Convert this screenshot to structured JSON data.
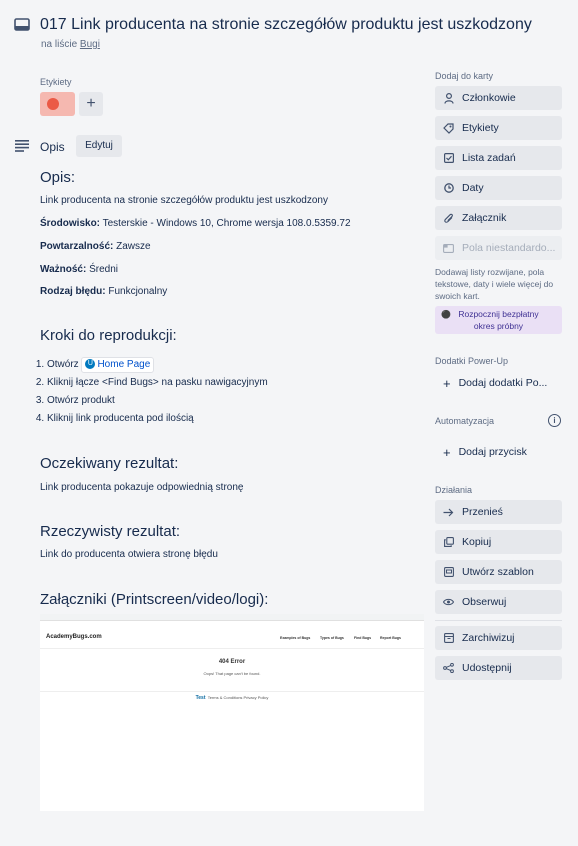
{
  "card": {
    "title": "017 Link producenta na stronie szczegółów produktu jest uszkodzony",
    "list_prefix": "na liście ",
    "list_name": "Bugi"
  },
  "labels": {
    "heading": "Etykiety",
    "color": "#eb5a46"
  },
  "description": {
    "section_label": "Opis",
    "edit_label": "Edytuj",
    "h_opis": "Opis:",
    "summary": "Link producenta na stronie szczegółów produktu jest uszkodzony",
    "env_label": "Środowisko:",
    "env_value": " Testerskie - Windows 10, Chrome wersja 108.0.5359.72",
    "rep_label": "Powtarzalność:",
    "rep_value": " Zawsze",
    "sev_label": "Ważność:",
    "sev_value": " Średni",
    "type_label": "Rodzaj błędu:",
    "type_value": " Funkcjonalny",
    "h_steps": "Kroki do reprodukcji:",
    "step1_prefix": "Otwórz ",
    "step1_link": "Home Page",
    "step2": "Kliknij łącze <Find Bugs> na pasku nawigacyjnym",
    "step3": "Otwórz produkt",
    "step4": "Kliknij link producenta pod ilością",
    "h_expected": "Oczekiwany rezultat:",
    "expected": "Link producenta pokazuje odpowiednią stronę",
    "h_actual": "Rzeczywisty rezultat:",
    "actual": "Link do producenta otwiera stronę błędu",
    "h_attachments": "Załączniki (Printscreen/video/logi):"
  },
  "attachment": {
    "brand": "AcademyBugs.com",
    "nav": [
      "Examples of Bugs",
      "Types of Bugs",
      "Find Bugs",
      "Report Bugs"
    ],
    "error_title": "404 Error",
    "error_sub": "Oops! That page can't be found.",
    "footer_brand": "Test",
    "footer_links": "Terms & Conditions   Privacy Policy"
  },
  "sidebar": {
    "add_heading": "Dodaj do karty",
    "members": "Członkowie",
    "labels": "Etykiety",
    "checklist": "Lista zadań",
    "dates": "Daty",
    "attachment": "Załącznik",
    "custom_fields": "Pola niestandardo...",
    "hint": "Dodawaj listy rozwijane, pola tekstowe, daty i wiele więcej do swoich kart.",
    "trial": "Rozpocznij bezpłatny okres próbny",
    "powerups_heading": "Dodatki Power-Up",
    "add_powerups": "Dodaj dodatki Po...",
    "automation_heading": "Automatyzacja",
    "add_button": "Dodaj przycisk",
    "actions_heading": "Działania",
    "move": "Przenieś",
    "copy": "Kopiuj",
    "template": "Utwórz szablon",
    "watch": "Obserwuj",
    "archive": "Zarchiwizuj",
    "share": "Udostępnij"
  }
}
